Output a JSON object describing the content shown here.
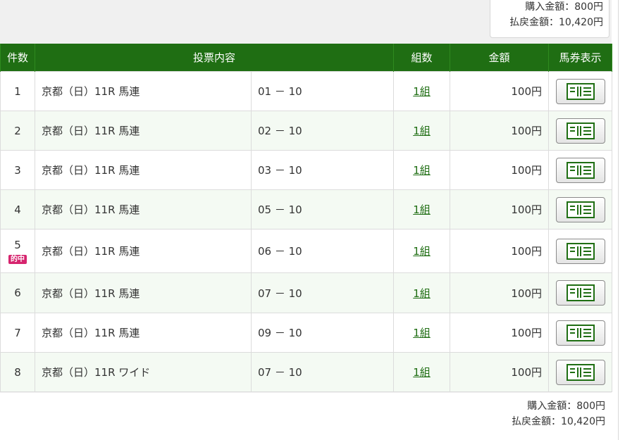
{
  "summary": {
    "purchase_label": "購入金額：",
    "purchase_value": "800円",
    "payout_label": "払戻金額：",
    "payout_value": "10,420円"
  },
  "table": {
    "headers": {
      "count": "件数",
      "content": "投票内容",
      "kumi": "組数",
      "amount": "金額",
      "ticket": "馬券表示"
    },
    "rows": [
      {
        "num": "1",
        "race": "京都（日）11R 馬連",
        "combo": "01 － 10",
        "kumi": "1組",
        "amount": "100円",
        "hit": ""
      },
      {
        "num": "2",
        "race": "京都（日）11R 馬連",
        "combo": "02 － 10",
        "kumi": "1組",
        "amount": "100円",
        "hit": ""
      },
      {
        "num": "3",
        "race": "京都（日）11R 馬連",
        "combo": "03 － 10",
        "kumi": "1組",
        "amount": "100円",
        "hit": ""
      },
      {
        "num": "4",
        "race": "京都（日）11R 馬連",
        "combo": "05 － 10",
        "kumi": "1組",
        "amount": "100円",
        "hit": ""
      },
      {
        "num": "5",
        "race": "京都（日）11R 馬連",
        "combo": "06 － 10",
        "kumi": "1組",
        "amount": "100円",
        "hit": "的中"
      },
      {
        "num": "6",
        "race": "京都（日）11R 馬連",
        "combo": "07 － 10",
        "kumi": "1組",
        "amount": "100円",
        "hit": ""
      },
      {
        "num": "7",
        "race": "京都（日）11R 馬連",
        "combo": "09 － 10",
        "kumi": "1組",
        "amount": "100円",
        "hit": ""
      },
      {
        "num": "8",
        "race": "京都（日）11R ワイド",
        "combo": "07 － 10",
        "kumi": "1組",
        "amount": "100円",
        "hit": ""
      }
    ]
  },
  "colors": {
    "header_green": "#1f6e13",
    "link_green": "#1f6e13",
    "hit_badge": "#d6246e"
  },
  "icons": {
    "ticket": "ticket-view-icon"
  }
}
